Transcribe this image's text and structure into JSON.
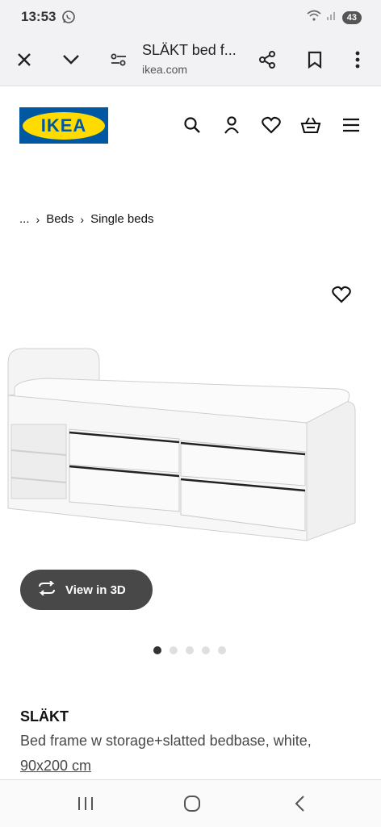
{
  "status_bar": {
    "time": "13:53",
    "battery": "43"
  },
  "browser": {
    "title": "SLÄKT bed f...",
    "url": "ikea.com"
  },
  "site": {
    "logo_text": "IKEA",
    "brand_blue": "#0058a3",
    "brand_yellow": "#ffdb00"
  },
  "breadcrumb": {
    "ellipsis": "...",
    "items": [
      "Beds",
      "Single beds"
    ]
  },
  "gallery": {
    "view3d_label": "View in 3D",
    "dot_count": 5,
    "active_dot": 0
  },
  "product": {
    "name": "SLÄKT",
    "description": "Bed frame w storage+slatted bedbase, white,",
    "size": "90x200 cm"
  }
}
